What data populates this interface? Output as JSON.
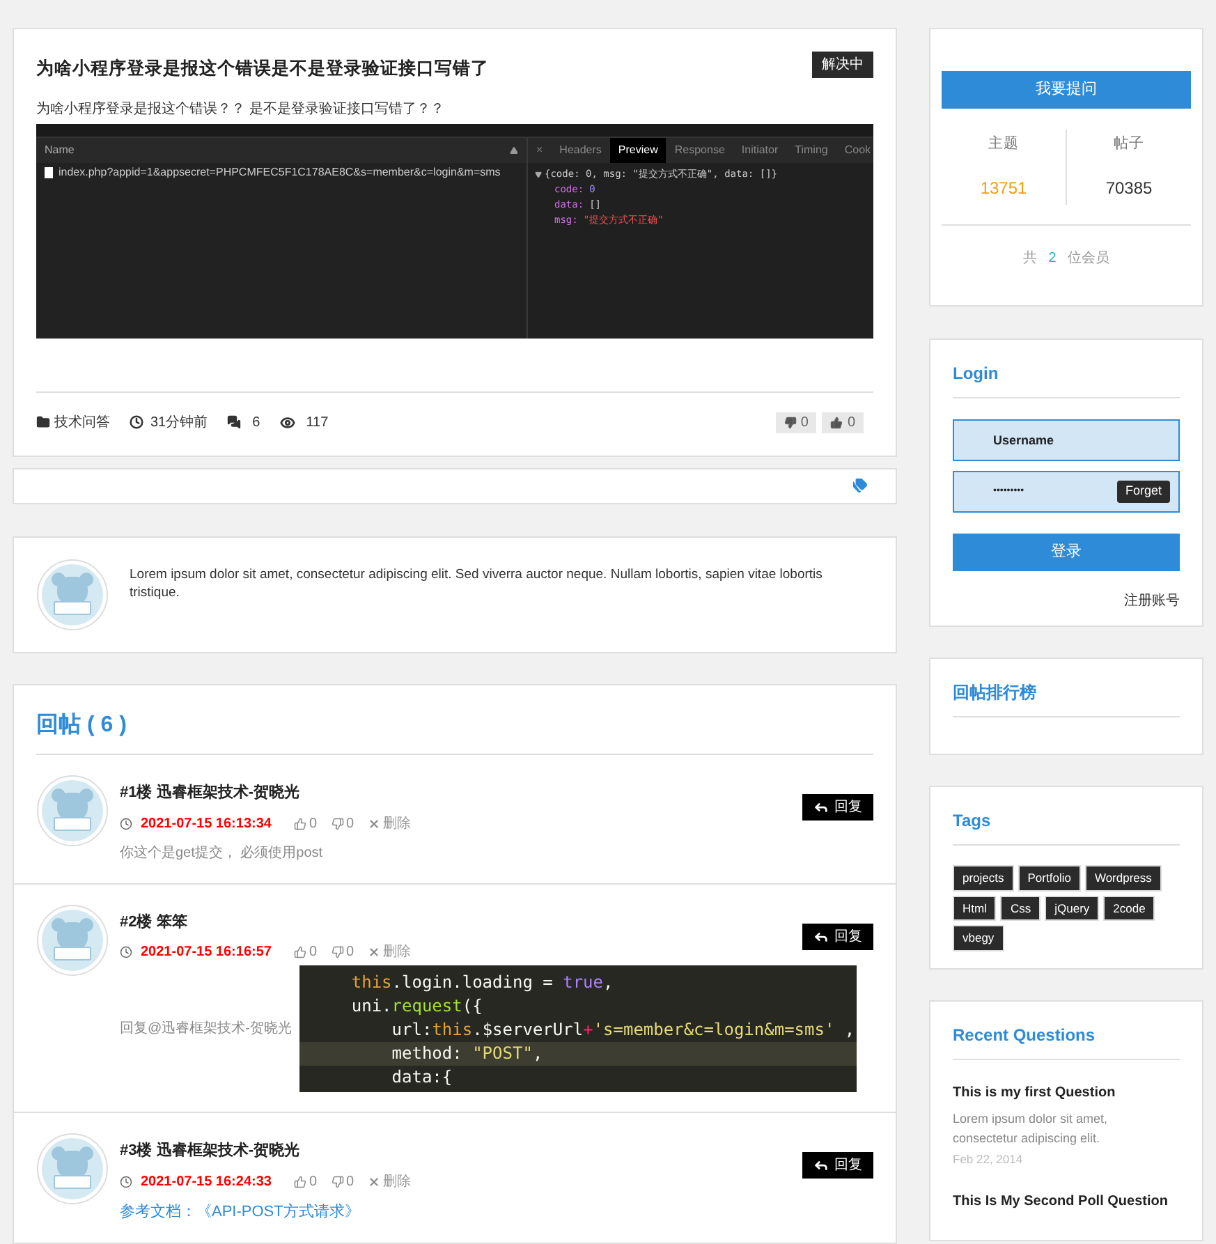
{
  "post": {
    "title": "为啥小程序登录是报这个错误是不是登录验证接口写错了",
    "status": "解决中",
    "description": "为啥小程序登录是报这个错误？？ 是不是登录验证接口写错了？？",
    "screenshot": {
      "name_header": "Name",
      "request": "index.php?appid=1&appsecret=PHPCMFEC5F1C178AE8C&s=member&c=login&m=sms",
      "close": "×",
      "tabs": [
        {
          "label": "Headers",
          "selected": false
        },
        {
          "label": "Preview",
          "selected": true
        },
        {
          "label": "Response",
          "selected": false
        },
        {
          "label": "Initiator",
          "selected": false
        },
        {
          "label": "Timing",
          "selected": false
        },
        {
          "label": "Cook",
          "selected": false
        }
      ],
      "summary": "{code: 0, msg: \"提交方式不正确\", data: []}",
      "fields": [
        {
          "key": "code:",
          "value": "0",
          "kind": "number"
        },
        {
          "key": "data:",
          "value": "[]",
          "kind": "plain"
        },
        {
          "key": "msg:",
          "value": "\"提交方式不正确\"",
          "kind": "string"
        }
      ]
    },
    "category": "技术问答",
    "time": "31分钟前",
    "comments": "6",
    "views": "117",
    "dislikes": "0",
    "likes": "0"
  },
  "author_bio": "Lorem ipsum dolor sit amet, consectetur adipiscing elit. Sed viverra auctor neque. Nullam lobortis, sapien vitae lobortis tristique.",
  "replies_heading": "回帖 ( 6 )",
  "replies": [
    {
      "floor": "#1楼",
      "author": "迅睿框架技术-贺晓光",
      "time": "2021-07-15 16:13:34",
      "likes": "0",
      "dislikes": "0",
      "delete": "删除",
      "reply": "回复",
      "content": {
        "kind": "text",
        "text": "你这个是get提交， 必须使用post"
      }
    },
    {
      "floor": "#2楼",
      "author": "笨笨",
      "time": "2021-07-15 16:16:57",
      "likes": "0",
      "dislikes": "0",
      "delete": "删除",
      "reply": "回复",
      "content": {
        "kind": "code",
        "text": "回复@迅睿框架技术-贺晓光",
        "code": [
          {
            "highlighted": false,
            "tokens": [
              {
                "text": "    this",
                "kind": "keyword"
              },
              {
                "text": ".login.loading = ",
                "kind": "plain"
              },
              {
                "text": "true",
                "kind": "bool"
              },
              {
                "text": ",",
                "kind": "plain"
              }
            ]
          },
          {
            "highlighted": false,
            "tokens": [
              {
                "text": "    uni.",
                "kind": "plain"
              },
              {
                "text": "request",
                "kind": "func"
              },
              {
                "text": "({",
                "kind": "plain"
              }
            ]
          },
          {
            "highlighted": false,
            "tokens": [
              {
                "text": "        url:",
                "kind": "plain"
              },
              {
                "text": "this",
                "kind": "keyword"
              },
              {
                "text": ".$serverUrl",
                "kind": "plain"
              },
              {
                "text": "+",
                "kind": "op"
              },
              {
                "text": "'s=member&c=login&m=sms'",
                "kind": "string"
              },
              {
                "text": " ,",
                "kind": "plain"
              }
            ]
          },
          {
            "highlighted": true,
            "tokens": [
              {
                "text": "        method: ",
                "kind": "plain"
              },
              {
                "text": "\"POST\"",
                "kind": "string"
              },
              {
                "text": ",",
                "kind": "plain"
              }
            ]
          },
          {
            "highlighted": false,
            "tokens": [
              {
                "text": "        data:{",
                "kind": "plain"
              }
            ]
          }
        ]
      }
    },
    {
      "floor": "#3楼",
      "author": "迅睿框架技术-贺晓光",
      "time": "2021-07-15 16:24:33",
      "likes": "0",
      "dislikes": "0",
      "delete": "删除",
      "reply": "回复",
      "content": {
        "kind": "link",
        "text": "参考文档：《API-POST方式请求》"
      }
    }
  ],
  "sidebar": {
    "ask_button": "我要提问",
    "stats": [
      {
        "label": "主题",
        "value": "13751",
        "color": "#f39c12"
      },
      {
        "label": "帖子",
        "value": "70385",
        "color": "#333333"
      }
    ],
    "members": {
      "prefix": "共",
      "count": "2",
      "suffix": "位会员"
    },
    "login": {
      "title": "Login",
      "username": "Username",
      "password": "•••••••••",
      "forget": "Forget",
      "submit": "登录",
      "register": "注册账号"
    },
    "ranking_title": "回帖排行榜",
    "tags_title": "Tags",
    "tags": [
      "projects",
      "Portfolio",
      "Wordpress",
      "Html",
      "Css",
      "jQuery",
      "2code",
      "vbegy"
    ],
    "recent_title": "Recent Questions",
    "recent": [
      {
        "title": "This is my first Question",
        "excerpt": "Lorem ipsum dolor sit amet, consectetur adipiscing elit.",
        "date": "Feb 22, 2014"
      },
      {
        "title": "This Is My Second Poll Question"
      }
    ]
  }
}
